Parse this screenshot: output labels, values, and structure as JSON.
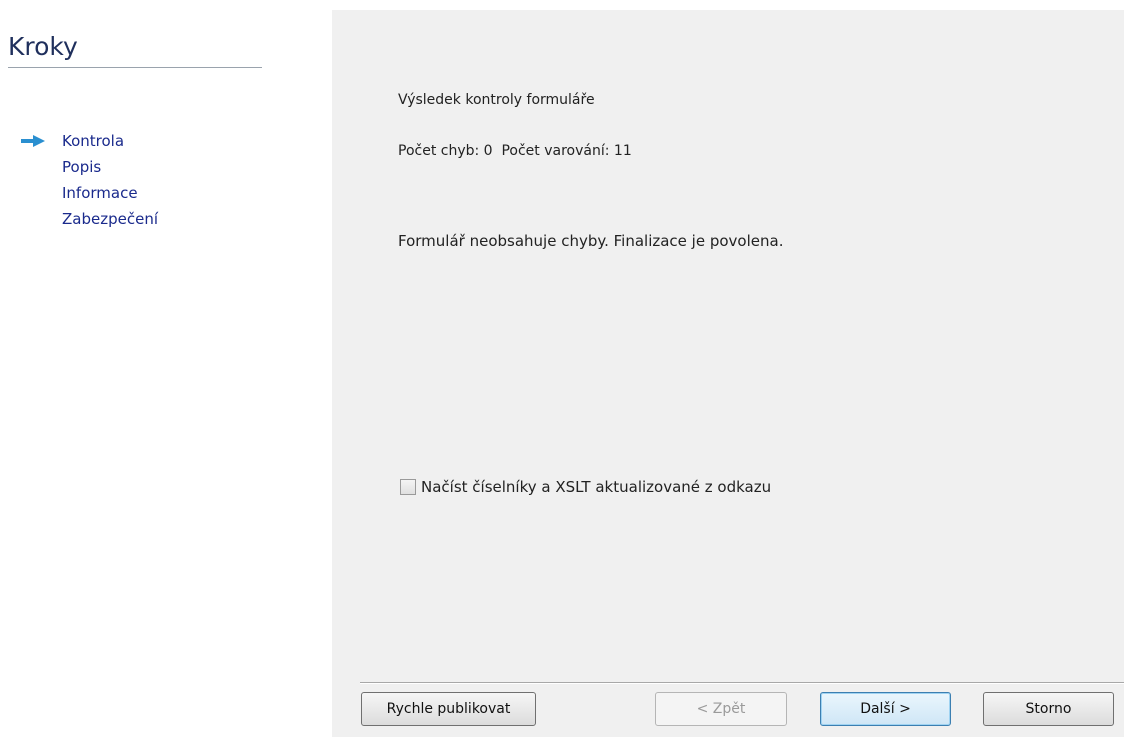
{
  "sidebar": {
    "title": "Kroky",
    "items": [
      {
        "label": "Kontrola",
        "active": true,
        "icon": "arrow-right-icon"
      },
      {
        "label": "Popis",
        "active": false
      },
      {
        "label": "Informace",
        "active": false
      },
      {
        "label": "Zabezpečení",
        "active": false
      }
    ]
  },
  "main": {
    "result_heading": "Výsledek kontroly formuláře",
    "counts": "Počet chyb: 0  Počet varování: 11",
    "status_message": "Formulář neobsahuje chyby. Finalizace je povolena.",
    "checkbox": {
      "label": "Načíst číselníky a XSLT aktualizované z odkazu",
      "checked": false
    }
  },
  "footer": {
    "quick_publish_label": "Rychle publikovat",
    "back_label": "< Zpět",
    "next_label": "Další >",
    "cancel_label": "Storno"
  },
  "colors": {
    "accent": "#1a2a8c",
    "arrow": "#2a8fd0",
    "panel_bg": "#f0f0f0"
  }
}
